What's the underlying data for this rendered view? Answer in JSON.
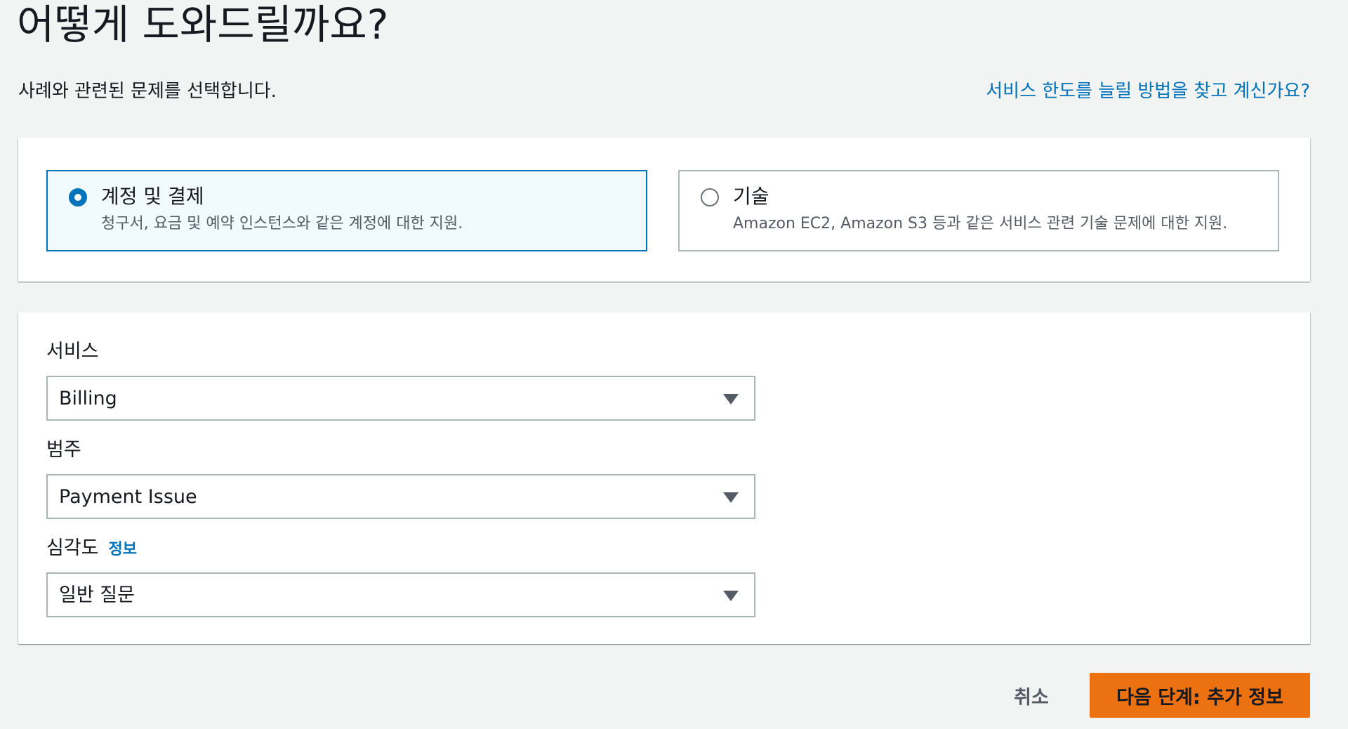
{
  "header": {
    "title": "어떻게 도와드릴까요?",
    "subtitle": "사례와 관련된 문제를 선택합니다.",
    "quota_link": "서비스 한도를 늘릴 방법을 찾고 계신가요?"
  },
  "case_type": {
    "selected": "account",
    "options": [
      {
        "label": "계정 및 결제",
        "description": "청구서, 요금 및 예약 인스턴스와 같은 계정에 대한 지원."
      },
      {
        "label": "기술",
        "description": "Amazon EC2, Amazon S3 등과 같은 서비스 관련 기술 문제에 대한 지원."
      }
    ]
  },
  "form": {
    "service": {
      "label": "서비스",
      "value": "Billing"
    },
    "category": {
      "label": "범주",
      "value": "Payment Issue"
    },
    "severity": {
      "label": "심각도",
      "info": "정보",
      "value": "일반 질문"
    }
  },
  "actions": {
    "cancel": "취소",
    "next": "다음 단계: 추가 정보"
  },
  "colors": {
    "accent": "#0073bb",
    "primary_button": "#ec7211",
    "background": "#f2f3f3"
  }
}
